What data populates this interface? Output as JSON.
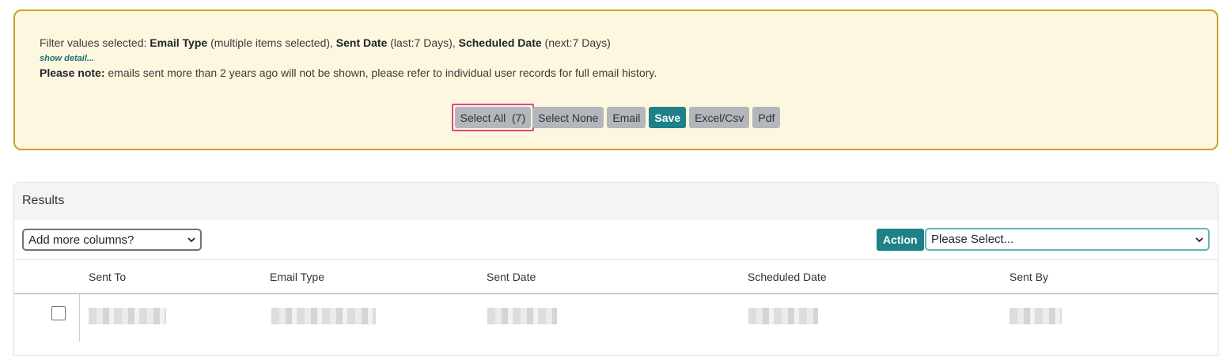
{
  "filter": {
    "prefix": "Filter values selected: ",
    "email_type_label": "Email Type",
    "email_type_value": " (multiple items selected), ",
    "sent_date_label": "Sent Date",
    "sent_date_value": " (last:7 Days), ",
    "scheduled_date_label": "Scheduled Date",
    "scheduled_date_value": " (next:7 Days)",
    "show_detail": "show detail...",
    "note_label": "Please note:",
    "note_text": " emails sent more than 2 years ago will not be shown, please refer to individual user records for full email history."
  },
  "buttons": {
    "select_all": "Select All",
    "select_all_count": "(7)",
    "select_none": "Select None",
    "email": "Email",
    "save": "Save",
    "excel_csv": "Excel/Csv",
    "pdf": "Pdf"
  },
  "results": {
    "title": "Results",
    "add_columns": "Add more columns?",
    "action_label": "Action",
    "action_select": "Please Select..."
  },
  "table": {
    "headers": [
      "Sent To",
      "Email Type",
      "Sent Date",
      "Scheduled Date",
      "Sent By"
    ]
  },
  "colors": {
    "accent": "#1e8188",
    "filter_bg": "#fef7e0",
    "filter_border": "#c9a227",
    "highlight": "#e0458b"
  }
}
